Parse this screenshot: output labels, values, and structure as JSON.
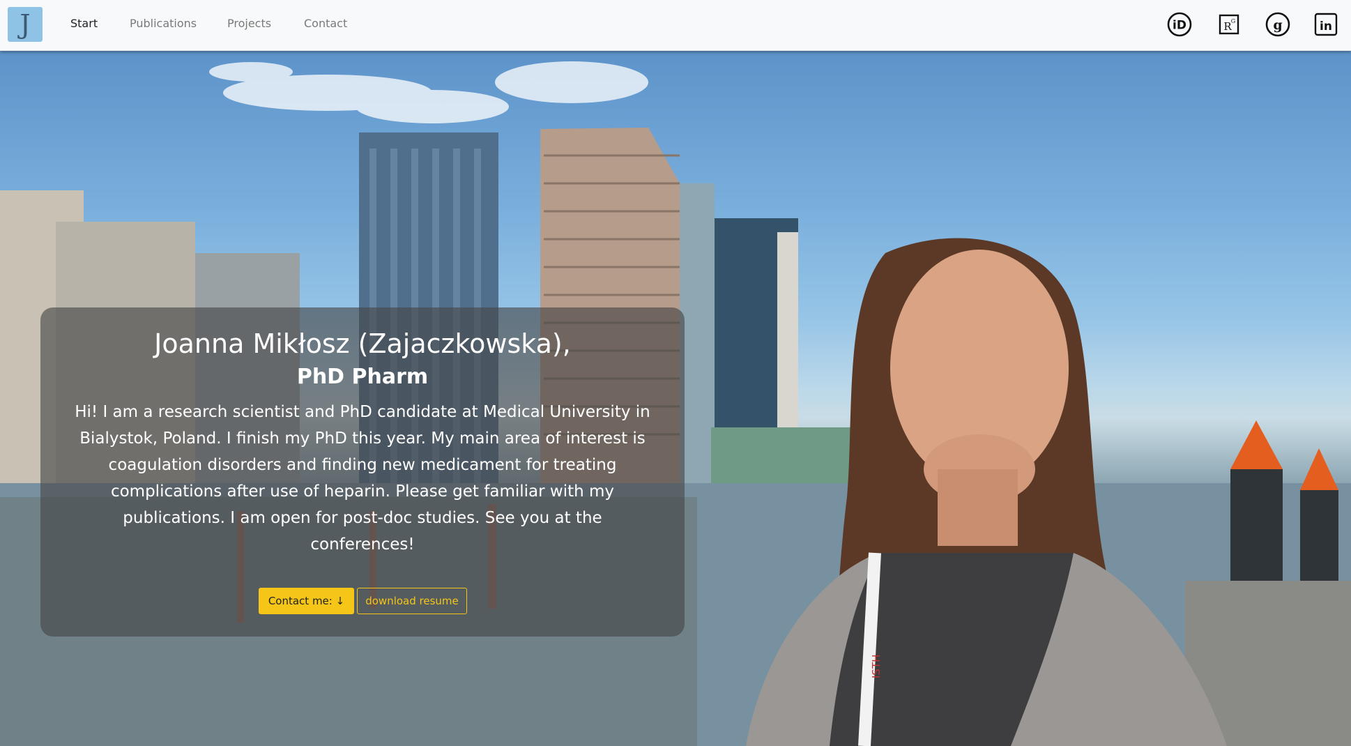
{
  "brand": {
    "letter": "J"
  },
  "nav": {
    "items": [
      {
        "label": "Start",
        "active": true
      },
      {
        "label": "Publications",
        "active": false
      },
      {
        "label": "Projects",
        "active": false
      },
      {
        "label": "Contact",
        "active": false
      }
    ]
  },
  "social": [
    {
      "icon": "orcid-icon"
    },
    {
      "icon": "researchgate-icon"
    },
    {
      "icon": "google-scholar-icon"
    },
    {
      "icon": "linkedin-icon"
    }
  ],
  "hero": {
    "name": "Joanna Mikłosz (Zajaczkowska),",
    "degree": "PhD Pharm",
    "bio": "Hi! I am a research scientist and PhD candidate at Medical University in Bialystok, Poland. I finish my PhD this year. My main area of interest is coagulation disorders and finding new medicament for treating complications after use of heparin. Please get familiar with my publications. I am open for post-doc studies. See you at the conferences!",
    "contact_button": "Contact me: ↓",
    "resume_button": "download resume",
    "lanyard_text": "ISTH"
  },
  "colors": {
    "accent": "#f5c518",
    "navbar_bg": "#f8f9fa",
    "brand_bg": "#8fc3e6"
  }
}
